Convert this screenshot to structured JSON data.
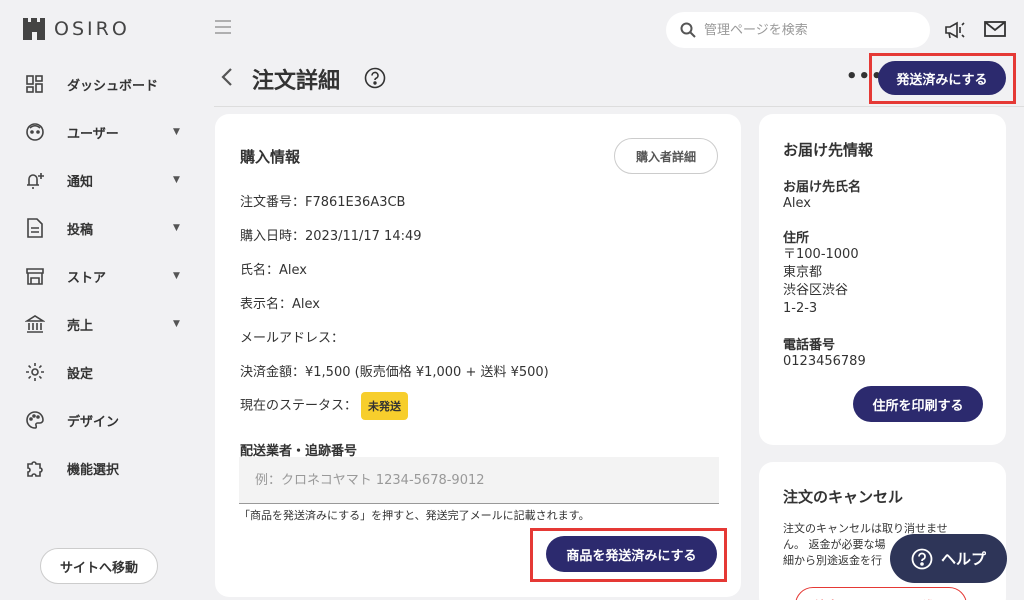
{
  "app": {
    "logo_text": "OSIRO"
  },
  "sidebar": {
    "items": [
      {
        "label": "ダッシュボード",
        "icon": "dashboard-icon",
        "has_caret": false
      },
      {
        "label": "ユーザー",
        "icon": "user-icon",
        "has_caret": true
      },
      {
        "label": "通知",
        "icon": "bell-plus-icon",
        "has_caret": true
      },
      {
        "label": "投稿",
        "icon": "document-icon",
        "has_caret": true
      },
      {
        "label": "ストア",
        "icon": "store-icon",
        "has_caret": true
      },
      {
        "label": "売上",
        "icon": "bank-icon",
        "has_caret": true
      },
      {
        "label": "設定",
        "icon": "gear-icon",
        "has_caret": false
      },
      {
        "label": "デザイン",
        "icon": "palette-icon",
        "has_caret": false
      },
      {
        "label": "機能選択",
        "icon": "puzzle-icon",
        "has_caret": false
      }
    ],
    "site_button": "サイトへ移動"
  },
  "topbar": {
    "search_placeholder": "管理ページを検索"
  },
  "header": {
    "title": "注文詳細",
    "mark_shipped": "発送済みにする"
  },
  "purchase": {
    "title": "購入情報",
    "buyer_detail": "購入者詳細",
    "order_no": "注文番号：F7861E36A3CB",
    "purchased_at": "購入日時：2023/11/17 14:49",
    "name": "氏名：Alex",
    "display_name": "表示名：Alex",
    "email": "メールアドレス：",
    "amount": "決済金額：¥1,500 (販売価格 ¥1,000 + 送料 ¥500)",
    "status_label": "現在のステータス：",
    "status_value": "未発送",
    "status_color": "#f7ce2c",
    "carrier_label": "配送業者・追跡番号",
    "carrier_placeholder": "例：クロネコヤマト 1234-5678-9012",
    "note": "「商品を発送済みにする」を押すと、発送完了メールに記載されます。",
    "ship_button": "商品を発送済みにする"
  },
  "delivery": {
    "title": "お届け先情報",
    "name_label": "お届け先氏名",
    "name_value": "Alex",
    "address_label": "住所",
    "address_lines": [
      "〒100-1000",
      "東京都",
      "渋谷区渋谷",
      "1-2-3"
    ],
    "phone_label": "電話番号",
    "phone_value": "0123456789",
    "print_button": "住所を印刷する"
  },
  "cancel": {
    "title": "注文のキャンセル",
    "text_lines": [
      "注文のキャンセルは取り消せませ",
      "ん。 返金が必要な場",
      "細から別途返金を行"
    ],
    "button": "注文のキャンセルに進む"
  },
  "help": {
    "label": "ヘルプ"
  },
  "colors": {
    "navy": "#2c2a6e",
    "highlight": "#e53935",
    "help_bg": "#2e3558",
    "cancel_red": "#e53935"
  }
}
